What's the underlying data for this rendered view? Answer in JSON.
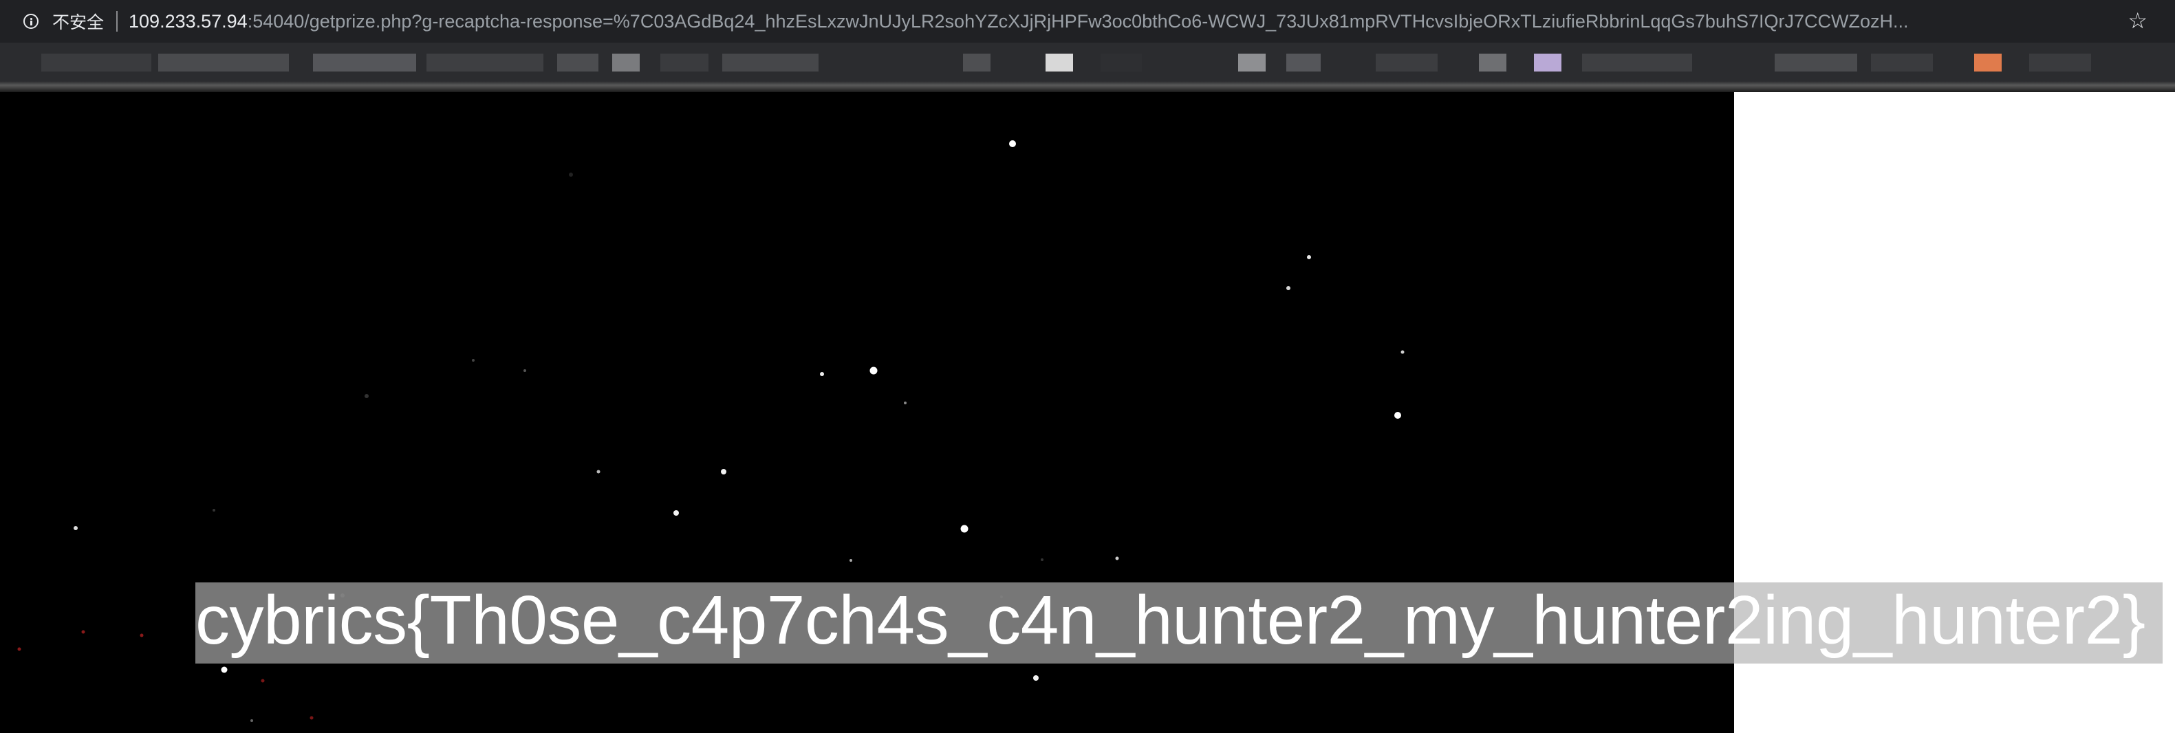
{
  "browser": {
    "security_label": "不安全",
    "url_host": "109.233.57.94",
    "url_rest": ":54040/getprize.php?g-recaptcha-response=%7C03AGdBq24_hhzEsLxzwJnUJyLR2sohYZcXJjRjHPFw3oc0bthCo6-WCWJ_73JUx81mpRVTHcvsIbjeORxTLziufieRbbrinLqqGs7buhS7IQrJ7CCWZozH...",
    "bookmark_icon": "star-outline-icon"
  },
  "page": {
    "flag_text": "cybrics{Th0se_c4p7ch4s_c4n_hunter2_my_hunter2ing_hunter2}"
  },
  "colors": {
    "browser_chrome": "#202124",
    "starfield_background": "#000000",
    "page_background": "#ffffff",
    "selection_highlight": "#808080",
    "selection_highlight_light": "#c8c8c8",
    "flag_text": "#ffffff",
    "bookmark_chip_lavender": "#b9a9d6",
    "bookmark_chip_orange": "#e07b4c"
  }
}
